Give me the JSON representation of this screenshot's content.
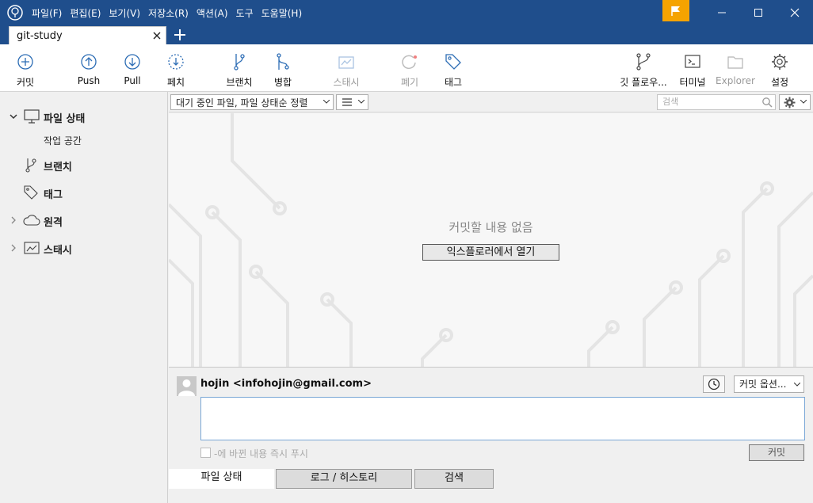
{
  "menubar": {
    "items": [
      "파일(F)",
      "편집(E)",
      "보기(V)",
      "저장소(R)",
      "액션(A)",
      "도구",
      "도움말(H)"
    ]
  },
  "tabs": {
    "active_label": "git-study"
  },
  "toolbar": {
    "commit": "커밋",
    "push": "Push",
    "pull": "Pull",
    "fetch": "페치",
    "branch": "브랜치",
    "merge": "병합",
    "stash": "스태시",
    "discard": "폐기",
    "tag": "태그",
    "git_flow": "깃 플로우...",
    "terminal": "터미널",
    "explorer": "Explorer",
    "settings": "설정"
  },
  "sidebar": {
    "file_status": "파일 상태",
    "working_copy": "작업 공간",
    "branches": "브랜치",
    "tags": "태그",
    "remotes": "원격",
    "stashes": "스태시"
  },
  "filterbar": {
    "sort_option": "대기 중인 파일, 파일 상태순 정렬",
    "search_placeholder": "검색"
  },
  "main": {
    "empty_message": "커밋할 내용 없음",
    "open_explorer": "익스플로러에서 열기"
  },
  "commit_panel": {
    "author": "hojin <infohojin@gmail.com>",
    "options_label": "커밋 옵션...",
    "push_immediately": "-에 바뀐 내용 즉시 푸시",
    "commit_button": "커밋"
  },
  "bottom_tabs": {
    "file_status": "파일 상태",
    "log_history": "로그 / 히스토리",
    "search": "검색"
  },
  "colors": {
    "titlebar": "#1f4e8c",
    "flag": "#f5a300",
    "icon_blue": "#2d6db5"
  }
}
